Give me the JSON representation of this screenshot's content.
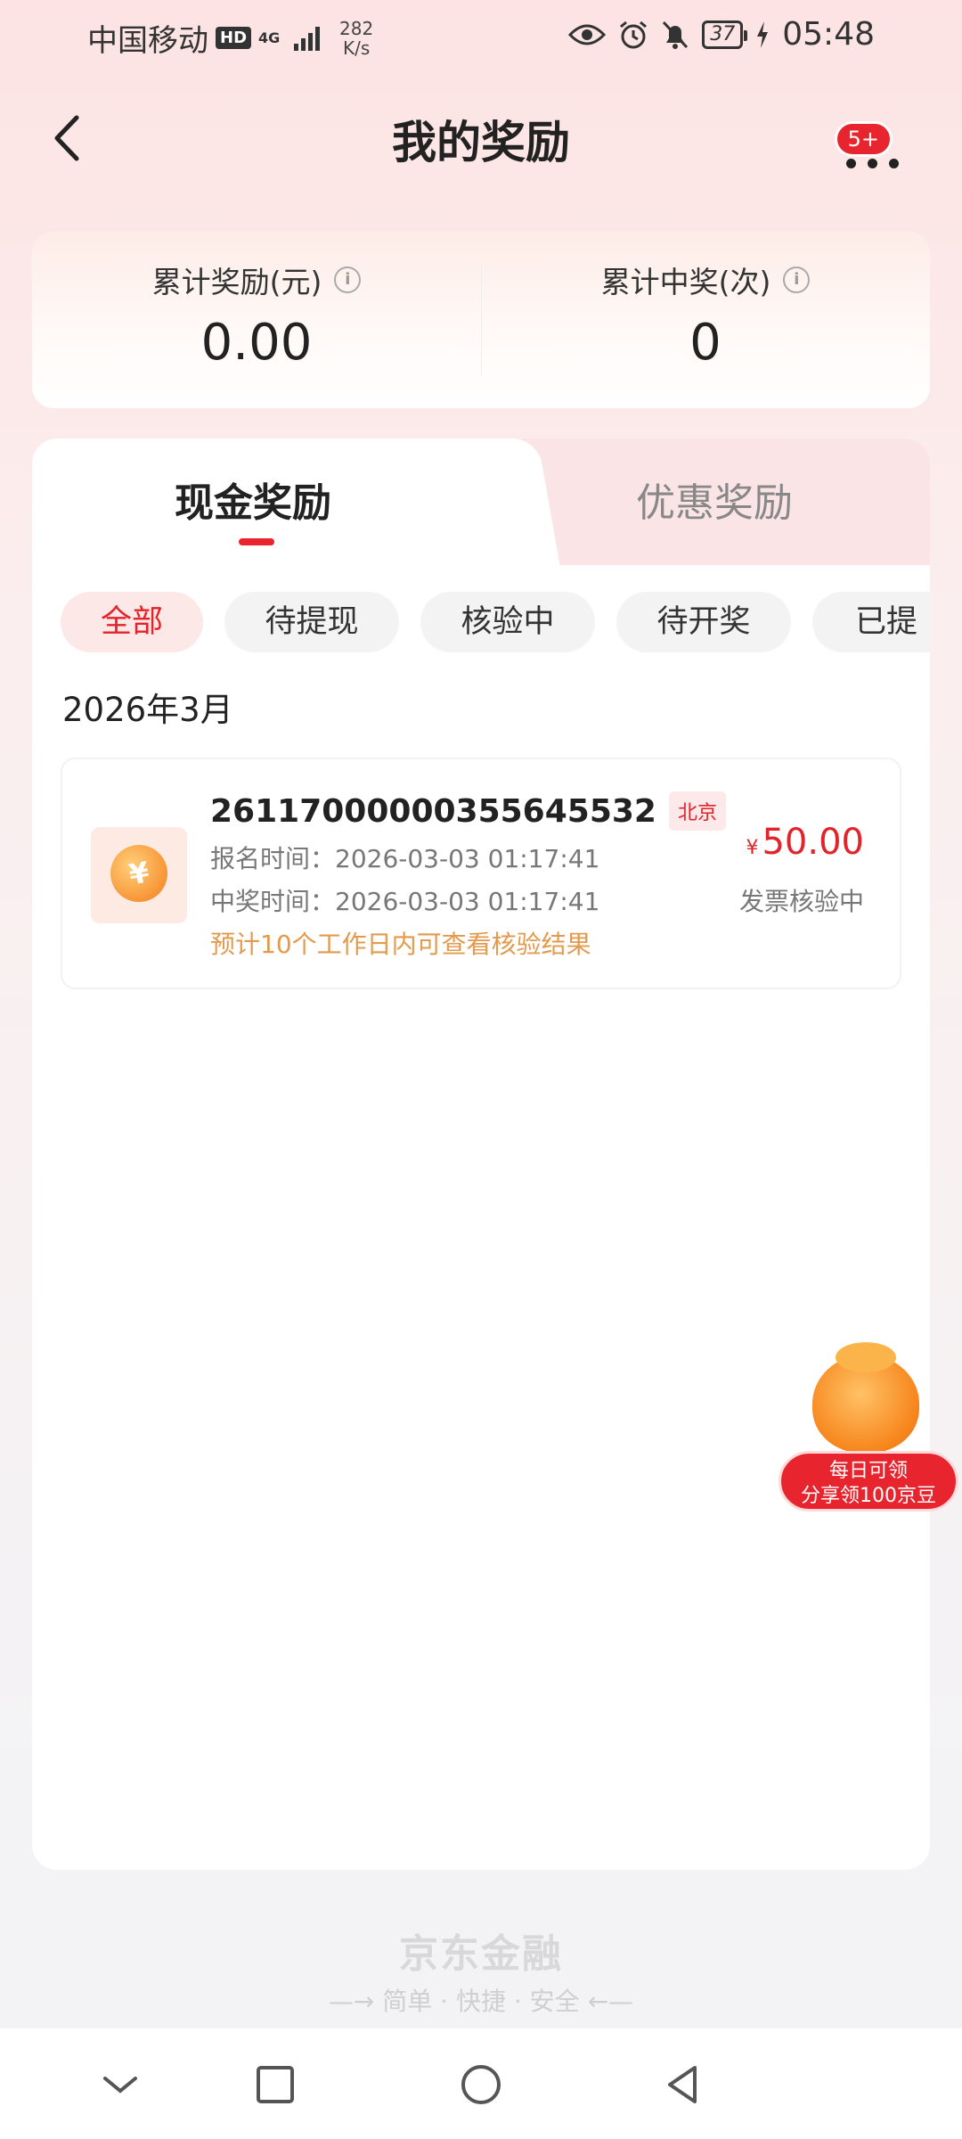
{
  "status_bar": {
    "carrier": "中国移动",
    "hd": "HD",
    "network": "4G",
    "speed_value": "282",
    "speed_unit": "K/s",
    "battery": "37",
    "time": "05:48"
  },
  "header": {
    "title": "我的奖励",
    "more_badge": "5+"
  },
  "summary": {
    "total_reward_label": "累计奖励(元)",
    "total_reward_value": "0.00",
    "total_wins_label": "累计中奖(次)",
    "total_wins_value": "0"
  },
  "tabs": {
    "cash": "现金奖励",
    "coupon": "优惠奖励"
  },
  "filters": [
    "全部",
    "待提现",
    "核验中",
    "待开奖",
    "已提"
  ],
  "month_label": "2026年3月",
  "record": {
    "order_no": "26117000000355645532",
    "city": "北京",
    "signup_time": "报名时间：2026-03-03 01:17:41",
    "win_time": "中奖时间：2026-03-03 01:17:41",
    "tip": "预计10个工作日内可查看核验结果",
    "currency": "¥",
    "amount": "50.00",
    "status": "发票核验中"
  },
  "floating_promo": {
    "line1": "每日可领",
    "line2": "分享领100京豆"
  },
  "footer": {
    "brand": "京东金融",
    "slogan": "—→ 简单 · 快捷 · 安全 ←—"
  },
  "icons": {
    "back": "chevron-left-icon",
    "more": "more-dots-icon",
    "info": "info-icon",
    "coin": "yuan-coin-icon"
  },
  "colors": {
    "accent": "#e8242e",
    "tip": "#e39a4c"
  }
}
